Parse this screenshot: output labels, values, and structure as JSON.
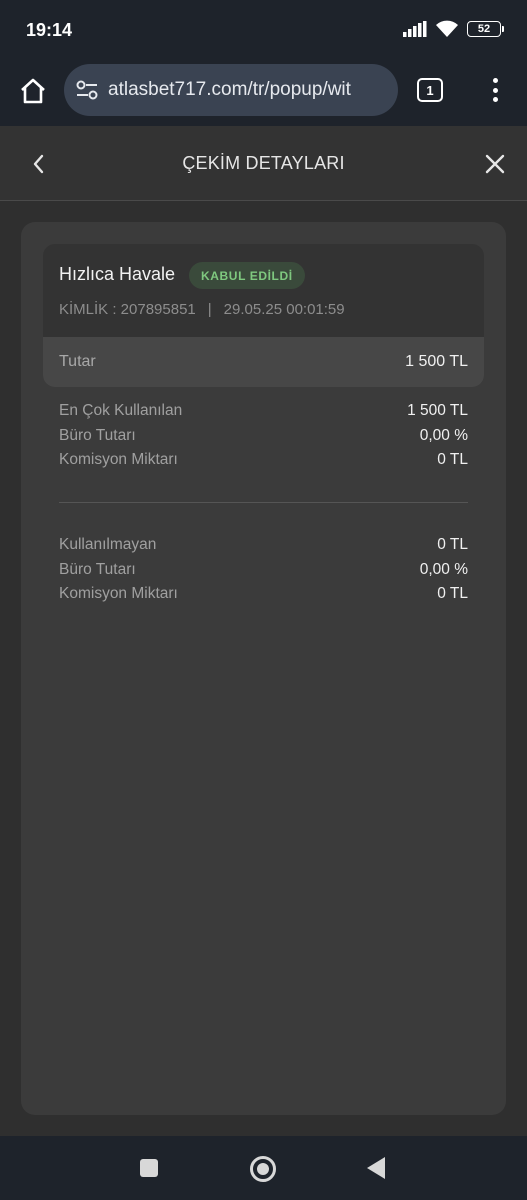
{
  "status_bar": {
    "time": "19:14",
    "battery": "52",
    "icons": [
      "signal-icon",
      "wifi-icon",
      "battery-icon"
    ]
  },
  "browser": {
    "url": "atlasbet717.com/tr/popup/wit",
    "tab_count": "1",
    "icons": [
      "home-icon",
      "site-settings-icon",
      "tabs-icon",
      "more-menu-icon"
    ]
  },
  "header": {
    "title": "ÇEKİM DETAYLARI",
    "icons": [
      "chevron-left-icon",
      "close-icon"
    ]
  },
  "transaction": {
    "method": "Hızlıca Havale",
    "status": "KABUL EDİLDİ",
    "id_text": "KİMLİK : 207895851",
    "separator": "|",
    "datetime": "29.05.25 00:01:59",
    "amount_label": "Tutar",
    "amount_value": "1 500 TL"
  },
  "group_used": [
    {
      "label": "En Çok Kullanılan",
      "value": "1 500 TL"
    },
    {
      "label": "Büro Tutarı",
      "value": "0,00 %"
    },
    {
      "label": "Komisyon Miktarı",
      "value": "0 TL"
    }
  ],
  "group_unused": [
    {
      "label": "Kullanılmayan",
      "value": "0 TL"
    },
    {
      "label": "Büro Tutarı",
      "value": "0,00 %"
    },
    {
      "label": "Komisyon Miktarı",
      "value": "0 TL"
    }
  ],
  "colors": {
    "badge_text": "#7fc87f",
    "badge_bg": "#3a4a3b",
    "system_bar": "#1e232b"
  }
}
